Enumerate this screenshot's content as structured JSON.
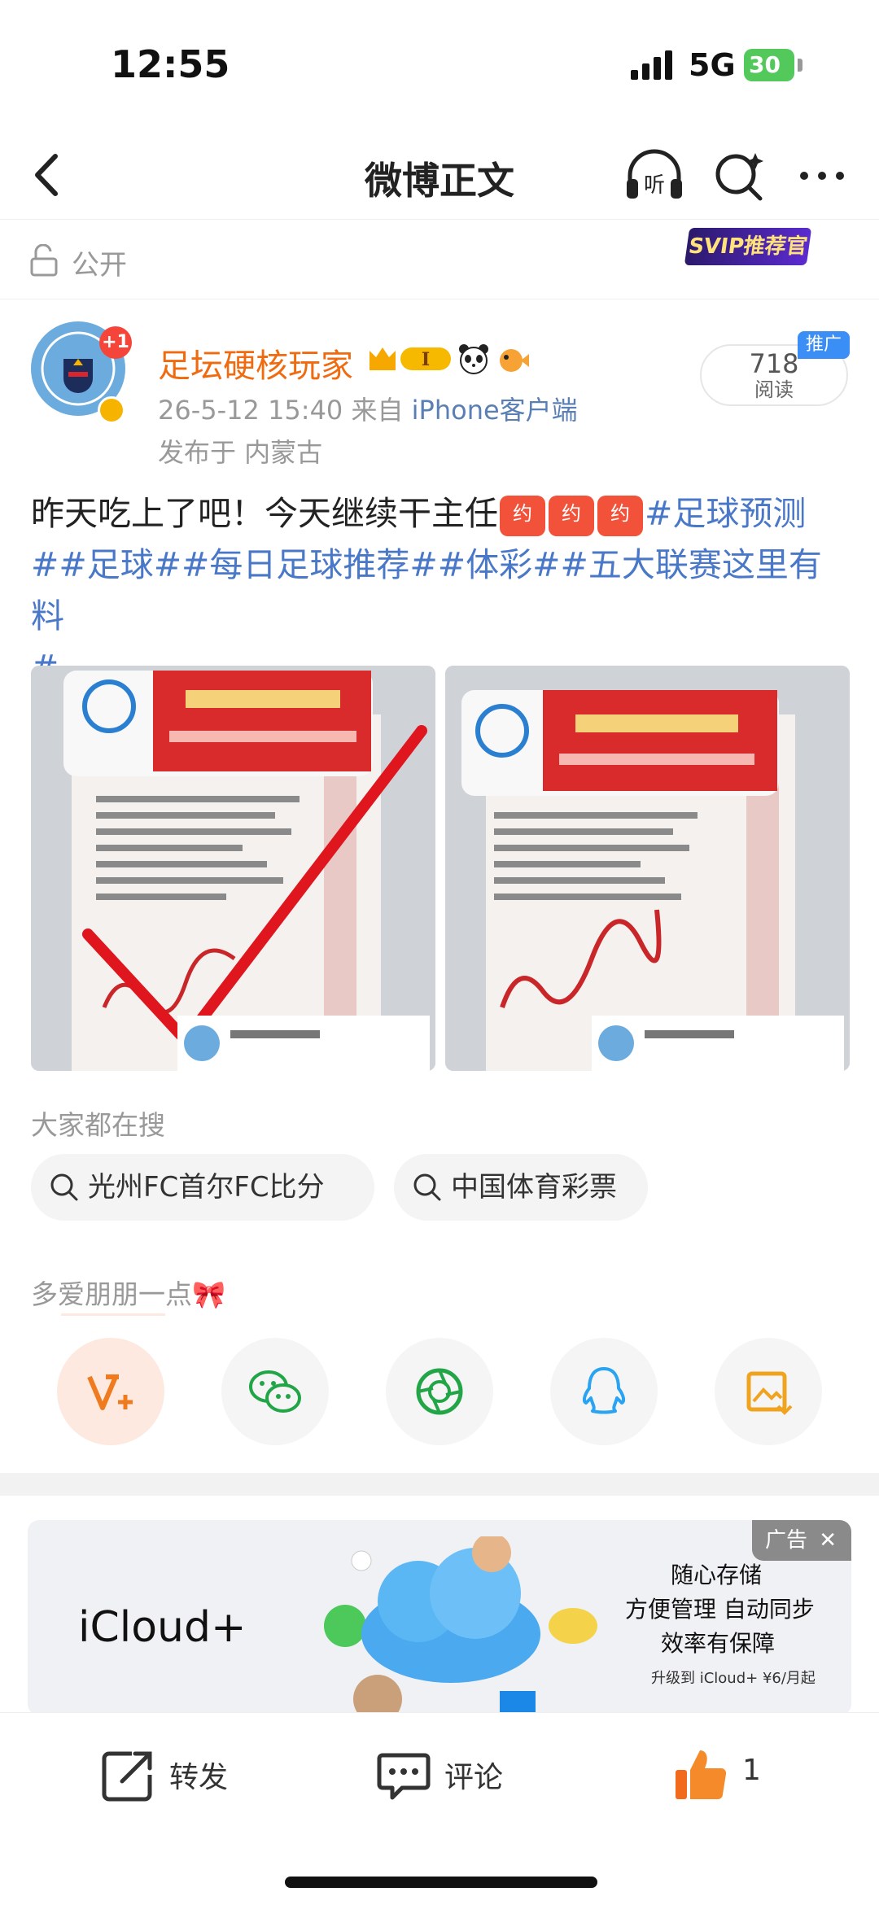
{
  "status_bar": {
    "time": "12:55",
    "network": "5G",
    "battery": "30"
  },
  "nav": {
    "title": "微博正文"
  },
  "visibility": {
    "label": "公开",
    "svip_badge": "SVIP推荐官"
  },
  "author": {
    "name": "足坛硬核玩家",
    "avatar_badge": "+1",
    "date": "26-5-12 15:40",
    "from_prefix": "来自",
    "source": "iPhone客户端",
    "location": "发布于 内蒙古",
    "reads": "718",
    "reads_label": "阅读",
    "promo_tag": "推广",
    "level": "I"
  },
  "post": {
    "text_main": "昨天吃上了吧！今天继续干主任",
    "emoji_label": "约",
    "tag1": "#足球预测",
    "tags_rest": "##足球##每日足球推荐##体彩##五大联赛这里有料",
    "tag_end": "#"
  },
  "search": {
    "label": "大家都在搜",
    "chips": [
      "光州FC首尔FC比分",
      "中国体育彩票"
    ]
  },
  "share": {
    "label": "多爱朋朋一点🎀"
  },
  "ad": {
    "tag": "广告",
    "logo": "iCloud+",
    "line1": "随心存储",
    "line2": "方便管理 自动同步",
    "line3": "效率有保障",
    "line4": "升级到 iCloud+ ¥6/月起"
  },
  "toolbar": {
    "repost": "转发",
    "comment": "评论",
    "like_count": "1"
  },
  "colors": {
    "accent": "#f06a0f",
    "link": "#4a78c8",
    "muted": "#999999"
  }
}
